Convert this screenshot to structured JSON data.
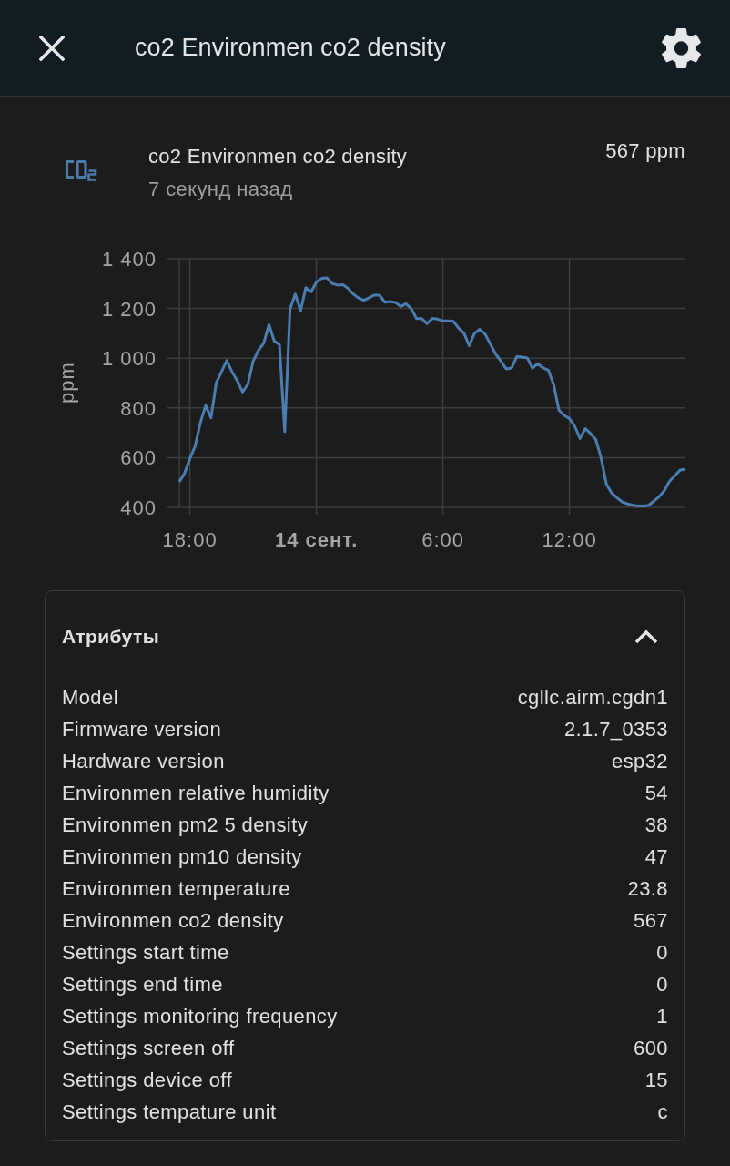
{
  "header": {
    "title": "co2 Environmen co2 density"
  },
  "entity": {
    "name": "co2 Environmen co2 density",
    "last_changed": "7 секунд назад",
    "state": "567 ppm"
  },
  "history": {
    "chart_data": {
      "type": "line",
      "ylabel": "ppm",
      "grid": true,
      "categories": [
        null,
        null,
        "18:00",
        null,
        null,
        null,
        null,
        null,
        null,
        null,
        null,
        null,
        null,
        null,
        null,
        null,
        null,
        null,
        null,
        null,
        null,
        null,
        null,
        null,
        null,
        null,
        "**14 сент.**",
        null,
        null,
        null,
        null,
        null,
        null,
        null,
        null,
        null,
        null,
        null,
        null,
        null,
        null,
        null,
        null,
        null,
        null,
        null,
        null,
        null,
        null,
        null,
        "6:00",
        null,
        null,
        null,
        null,
        null,
        null,
        null,
        null,
        null,
        null,
        null,
        null,
        null,
        null,
        null,
        null,
        null,
        null,
        null,
        null,
        null,
        null,
        null,
        "12:00",
        null,
        null,
        null,
        null,
        null,
        null,
        null,
        null,
        null,
        null,
        null,
        null,
        null,
        null,
        null,
        null,
        null,
        null,
        null,
        null,
        null,
        null
      ],
      "series": [
        {
          "color": "#4b7db2",
          "values": [
            503,
            537,
            596,
            646,
            742,
            810,
            760,
            900,
            945,
            990,
            945,
            909,
            864,
            895,
            988,
            1031,
            1060,
            1135,
            1069,
            1055,
            704,
            1197,
            1258,
            1190,
            1284,
            1267,
            1306,
            1321,
            1323,
            1300,
            1294,
            1296,
            1281,
            1258,
            1242,
            1233,
            1243,
            1254,
            1253,
            1225,
            1228,
            1224,
            1208,
            1219,
            1199,
            1159,
            1159,
            1139,
            1160,
            1157,
            1150,
            1150,
            1148,
            1120,
            1100,
            1050,
            1100,
            1116,
            1097,
            1057,
            1017,
            988,
            957,
            960,
            1006,
            1004,
            1001,
            960,
            978,
            961,
            952,
            895,
            791,
            770,
            757,
            726,
            677,
            717,
            697,
            673,
            600,
            494,
            458,
            439,
            422,
            414,
            409,
            405,
            405,
            408,
            425,
            443,
            467,
            506,
            527,
            550,
            553
          ]
        }
      ],
      "ylim": [
        400,
        1400
      ],
      "yticks": [
        400,
        600,
        800,
        {
          "value": 1000,
          "label": "1 000"
        },
        {
          "value": 1200,
          "label": "1 200"
        },
        {
          "value": 1400,
          "label": "1 400"
        }
      ]
    }
  },
  "attributes": {
    "title": "Атрибуты",
    "expanded": true,
    "rows": [
      {
        "label": "Model",
        "value": "cgllc.airm.cgdn1"
      },
      {
        "label": "Firmware version",
        "value": "2.1.7_0353"
      },
      {
        "label": "Hardware version",
        "value": "esp32"
      },
      {
        "label": "Environmen relative humidity",
        "value": "54"
      },
      {
        "label": "Environmen pm2 5 density",
        "value": "38"
      },
      {
        "label": "Environmen pm10 density",
        "value": "47"
      },
      {
        "label": "Environmen temperature",
        "value": "23.8"
      },
      {
        "label": "Environmen co2 density",
        "value": "567"
      },
      {
        "label": "Settings start time",
        "value": "0"
      },
      {
        "label": "Settings end time",
        "value": "0"
      },
      {
        "label": "Settings monitoring frequency",
        "value": "1"
      },
      {
        "label": "Settings screen off",
        "value": "600"
      },
      {
        "label": "Settings device off",
        "value": "15"
      },
      {
        "label": "Settings tempature unit",
        "value": "c"
      }
    ]
  }
}
